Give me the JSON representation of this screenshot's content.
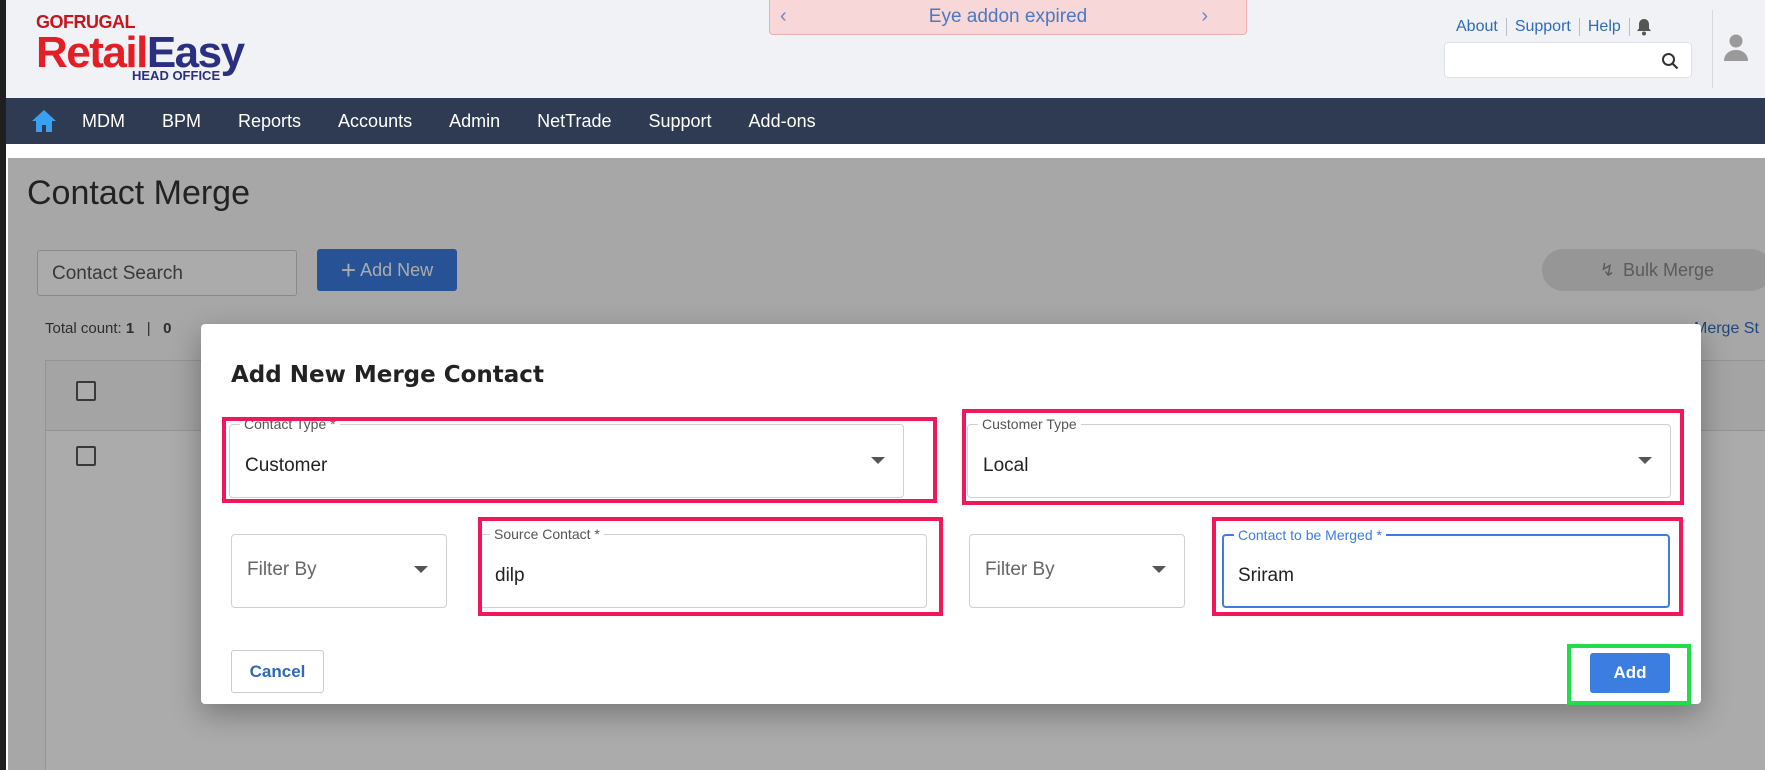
{
  "header": {
    "logo": {
      "top": "GOFRUGAL",
      "main_red": "Retail",
      "main_blue": "Easy",
      "sub": "HEAD OFFICE"
    },
    "banner_text": "Eye addon expired",
    "links": [
      "About",
      "Support",
      "Help"
    ],
    "search_placeholder": ""
  },
  "nav": {
    "items": [
      "MDM",
      "BPM",
      "Reports",
      "Accounts",
      "Admin",
      "NetTrade",
      "Support",
      "Add-ons"
    ]
  },
  "page": {
    "title": "Contact Merge",
    "search_placeholder": "Contact Search",
    "add_new_label": "Add New",
    "bulk_merge_label": "Bulk Merge",
    "total_count_label": "Total count:",
    "total_count_value": "1",
    "selected_count": "0",
    "merge_status_label": "Merge St"
  },
  "modal": {
    "title": "Add New Merge Contact",
    "contact_type": {
      "label": "Contact Type *",
      "value": "Customer"
    },
    "customer_type": {
      "label": "Customer Type",
      "value": "Local"
    },
    "filter_by_1": {
      "placeholder": "Filter By"
    },
    "source_contact": {
      "label": "Source Contact *",
      "value": "dilp"
    },
    "filter_by_2": {
      "placeholder": "Filter By"
    },
    "contact_to_merge": {
      "label": "Contact to be Merged *",
      "value": "Sriram"
    },
    "cancel_label": "Cancel",
    "add_label": "Add"
  },
  "colors": {
    "nav_bg": "#2f3b52",
    "primary": "#3b7de0",
    "highlight_red": "#f0175a",
    "highlight_green": "#22dc4a",
    "banner_bg": "#f7d7d7"
  }
}
